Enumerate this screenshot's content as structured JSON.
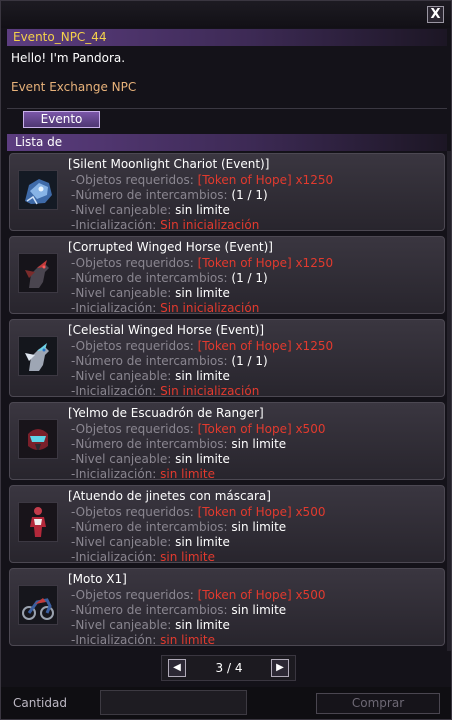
{
  "window": {
    "npc_title": "Evento_NPC_44",
    "greeting": "Hello! I'm Pandora.",
    "role": "Event Exchange NPC",
    "close_glyph": "X",
    "tab_label": "Evento",
    "list_header": "Lista de"
  },
  "labels": {
    "required": "-Objetos requeridos:",
    "exchanges": "-Número de intercambios:",
    "level": "-Nivel canjeable:",
    "init": "-Inicialización:"
  },
  "items": [
    {
      "name": "[Silent Moonlight Chariot (Event)]",
      "required": "[Token of Hope] x1250",
      "exchanges": "(1 / 1)",
      "level": "sin limite",
      "init": "Sin inicialización",
      "icon": "robot-mount-icon"
    },
    {
      "name": "[Corrupted Winged Horse (Event)]",
      "required": "[Token of Hope] x1250",
      "exchanges": "(1 / 1)",
      "level": "sin limite",
      "init": "Sin inicialización",
      "icon": "dark-horse-icon"
    },
    {
      "name": "[Celestial Winged Horse (Event)]",
      "required": "[Token of Hope] x1250",
      "exchanges": "(1 / 1)",
      "level": "sin limite",
      "init": "Sin inicialización",
      "icon": "white-horse-icon"
    },
    {
      "name": "[Yelmo de Escuadrón de Ranger]",
      "required": "[Token of Hope] x500",
      "exchanges": "sin limite",
      "level": "sin limite",
      "init": "sin limite",
      "icon": "helmet-icon"
    },
    {
      "name": "[Atuendo de jinetes con máscara]",
      "required": "[Token of Hope] x500",
      "exchanges": "sin limite",
      "level": "sin limite",
      "init": "sin limite",
      "icon": "outfit-icon"
    },
    {
      "name": "[Moto X1]",
      "required": "[Token of Hope] x500",
      "exchanges": "sin limite",
      "level": "sin limite",
      "init": "sin limite",
      "icon": "motorcycle-icon"
    }
  ],
  "pagination": {
    "text": "3 / 4",
    "prev_glyph": "◀",
    "next_glyph": "▶"
  },
  "footer": {
    "quantity_label": "Cantidad",
    "quantity_value": "",
    "buy_label": "Comprar"
  },
  "colors": {
    "accent": "#5c3d80",
    "title_text": "#f4d24a",
    "role_text": "#e8b27a",
    "required_text": "#e23a2e"
  }
}
